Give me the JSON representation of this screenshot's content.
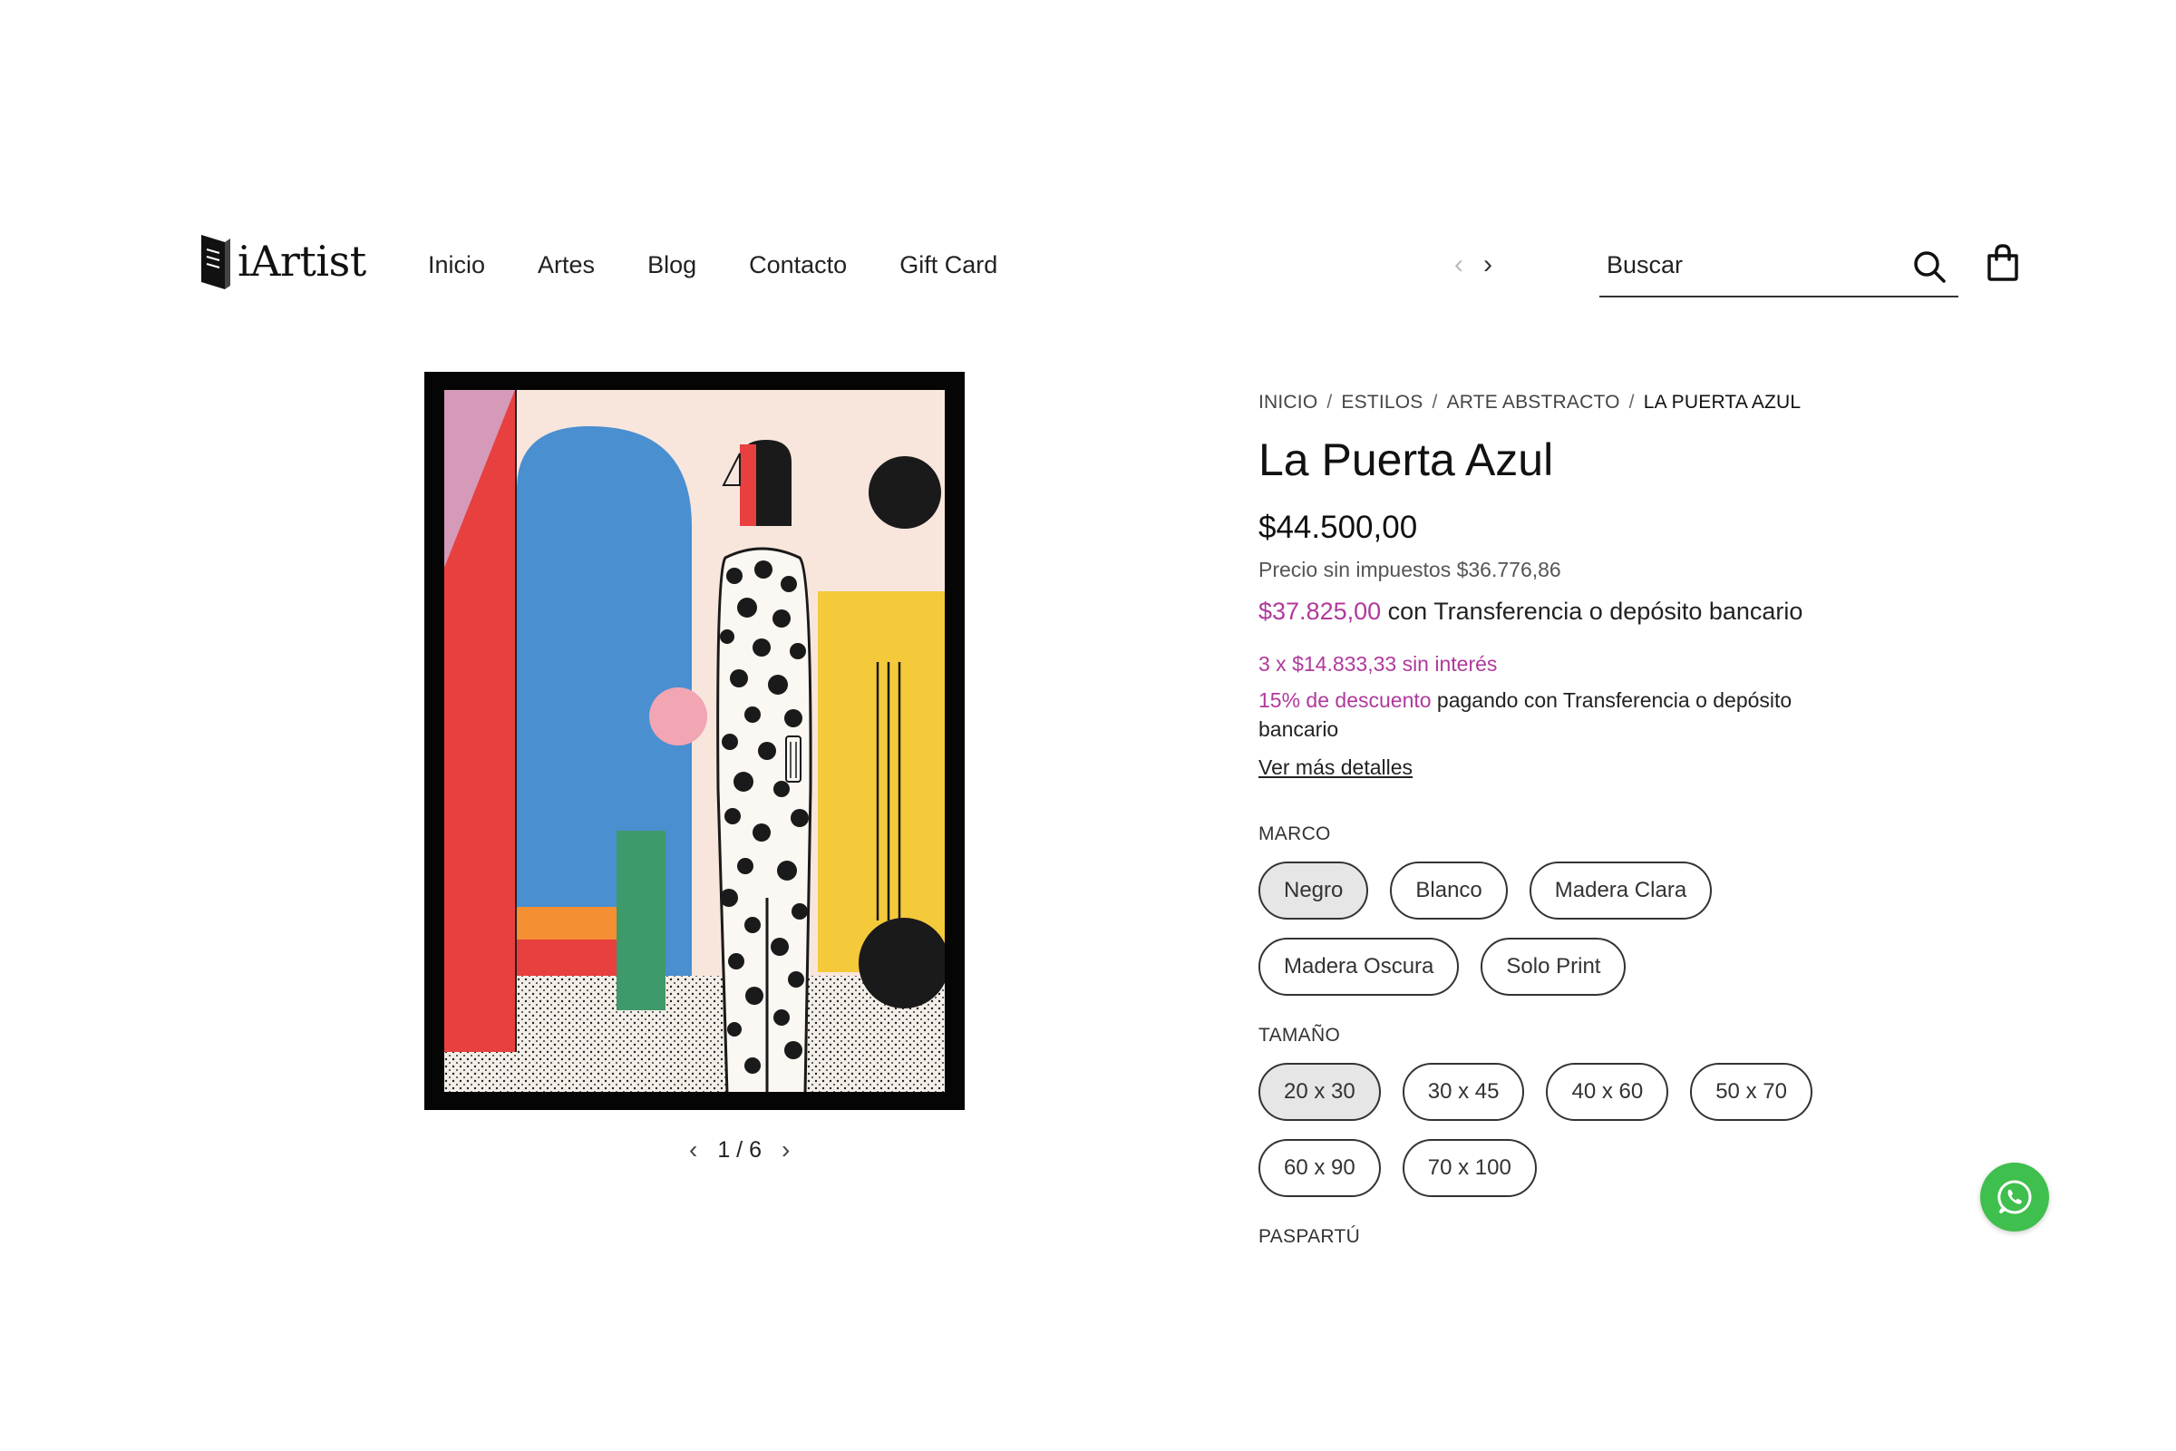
{
  "header": {
    "logo_text": "iArtist",
    "nav": [
      "Inicio",
      "Artes",
      "Blog",
      "Contacto",
      "Gift Card"
    ],
    "prev_arrow": "‹",
    "next_arrow": "›",
    "search_placeholder": "Buscar"
  },
  "gallery": {
    "prev": "‹",
    "next": "›",
    "counter": "1 / 6"
  },
  "product": {
    "breadcrumb": [
      "INICIO",
      "ESTILOS",
      "ARTE ABSTRACTO",
      "LA PUERTA AZUL"
    ],
    "breadcrumb_sep": "/",
    "title": "La Puerta Azul",
    "price": "$44.500,00",
    "tax_price": "Precio sin impuestos $36.776,86",
    "transfer_price": "$37.825,00",
    "transfer_text": " con Transferencia o depósito bancario",
    "installments": "3 x $14.833,33 sin interés",
    "discount_accent": "15% de descuento",
    "discount_text": " pagando con Transferencia o depósito bancario",
    "details_link": "Ver más detalles"
  },
  "options": {
    "frame_label": "MARCO",
    "frames": [
      "Negro",
      "Blanco",
      "Madera Clara",
      "Madera Oscura",
      "Solo Print"
    ],
    "frame_selected": "Negro",
    "size_label": "TAMAÑO",
    "sizes": [
      "20 x 30",
      "30 x 45",
      "40 x 60",
      "50 x 70",
      "60 x 90",
      "70 x 100"
    ],
    "size_selected": "20 x 30",
    "mat_label": "PASPARTÚ"
  },
  "colors": {
    "accent": "#b0399c",
    "whatsapp": "#3fbf4d"
  }
}
